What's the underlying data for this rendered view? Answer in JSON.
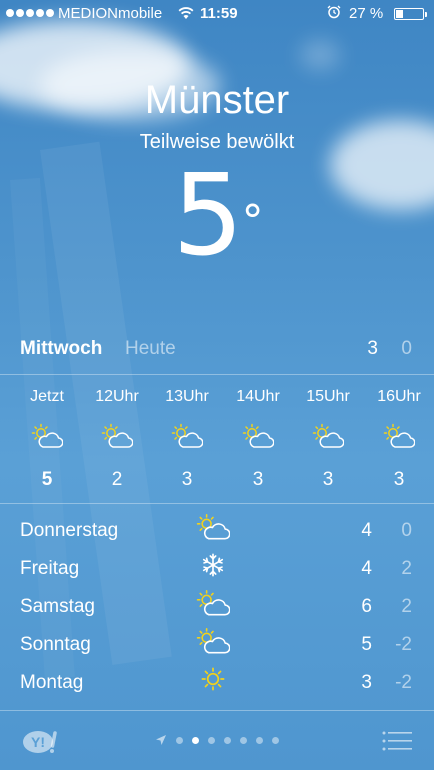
{
  "status_bar": {
    "carrier": "MEDIONmobile",
    "time": "11:59",
    "battery_percent": "27 %",
    "battery_level": 0.27,
    "signal_bars": 5,
    "icons": [
      "signal-dots-icon",
      "wifi-icon",
      "alarm-icon",
      "battery-icon"
    ]
  },
  "header": {
    "city": "Münster",
    "condition": "Teilweise bewölkt",
    "temperature": "5",
    "degree_symbol": "°"
  },
  "today": {
    "day": "Mittwoch",
    "label": "Heute",
    "high": "3",
    "low": "0"
  },
  "hourly": [
    {
      "time": "Jetzt",
      "icon": "sun-cloud-icon",
      "temp": "5"
    },
    {
      "time": "12Uhr",
      "icon": "sun-cloud-icon",
      "temp": "2"
    },
    {
      "time": "13Uhr",
      "icon": "sun-cloud-icon",
      "temp": "3"
    },
    {
      "time": "14Uhr",
      "icon": "sun-cloud-icon",
      "temp": "3"
    },
    {
      "time": "15Uhr",
      "icon": "sun-cloud-icon",
      "temp": "3"
    },
    {
      "time": "16Uhr",
      "icon": "sun-cloud-icon",
      "temp": "3"
    }
  ],
  "daily": [
    {
      "day": "Donnerstag",
      "icon": "sun-cloud-icon",
      "high": "4",
      "low": "0"
    },
    {
      "day": "Freitag",
      "icon": "snowflake-icon",
      "high": "4",
      "low": "2"
    },
    {
      "day": "Samstag",
      "icon": "sun-cloud-icon",
      "high": "6",
      "low": "2"
    },
    {
      "day": "Sonntag",
      "icon": "sun-cloud-icon",
      "high": "5",
      "low": "-2"
    },
    {
      "day": "Montag",
      "icon": "sun-icon",
      "high": "3",
      "low": "-2"
    }
  ],
  "footer": {
    "yahoo_logo": "Y!",
    "page_count": 7,
    "active_page": 1,
    "icons": [
      "yahoo-logo-icon",
      "location-arrow-icon",
      "list-icon"
    ]
  },
  "colors": {
    "background": "#4e94cd",
    "text": "#ffffff",
    "muted_text": "rgba(255,255,255,0.55)",
    "sun": "#f2d21b"
  }
}
